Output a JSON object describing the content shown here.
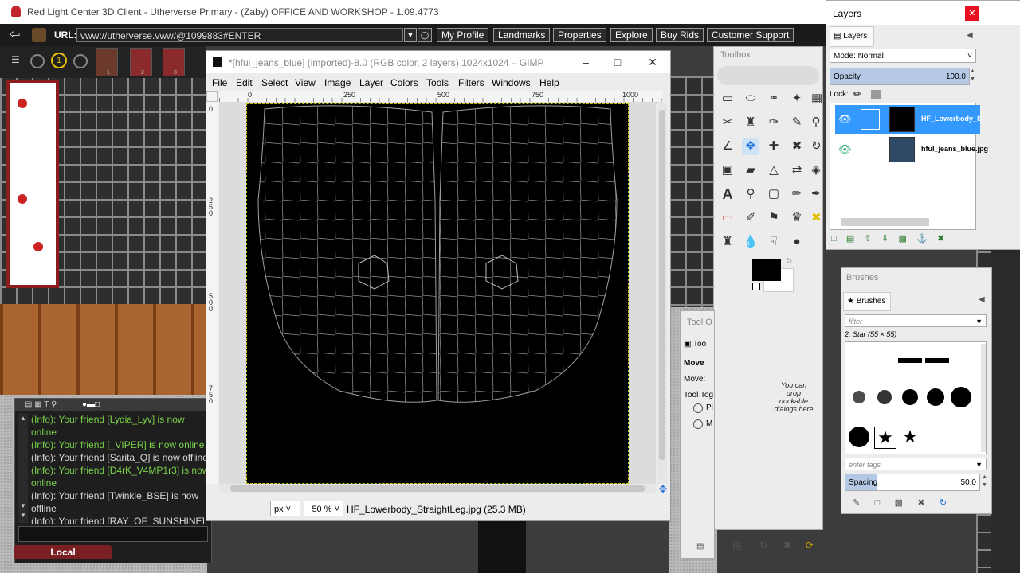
{
  "client": {
    "title": "Red Light Center 3D Client - Utherverse Primary - (Zaby) OFFICE AND WORKSHOP - 1.09.4773",
    "url_label": "URL:",
    "url_value": "vww://utherverse.vww/@1099883#ENTER",
    "nav_buttons": [
      "My Profile",
      "Landmarks",
      "Properties",
      "Explore",
      "Buy Rids",
      "Customer Support"
    ],
    "avatar_numbers": [
      "1",
      "2",
      "3"
    ]
  },
  "chat": {
    "lines": [
      {
        "text": "(Info): Your friend [Lydia_Lyv] is now online",
        "color": "#7ad14a"
      },
      {
        "text": "(Info): Your friend [_VIPER] is now online",
        "color": "#7ad14a"
      },
      {
        "text": "(Info): Your friend [Sarita_Q] is now offline",
        "color": "#d8d8d8"
      },
      {
        "text": "(Info): Your friend [D4rK_V4MP1r3] is now online",
        "color": "#7ad14a"
      },
      {
        "text": "(Info): Your friend [Twinkle_BSE] is now offline",
        "color": "#d8d8d8"
      },
      {
        "text": "(Info): Your friend [RAY_OF_SUNSHINE] is now offline",
        "color": "#d8d8d8"
      }
    ],
    "channel_label": "Local"
  },
  "gimp": {
    "title": "*[hful_jeans_blue] (imported)-8.0 (RGB color, 2 layers) 1024x1024 – GIMP",
    "menu": [
      "File",
      "Edit",
      "Select",
      "View",
      "Image",
      "Layer",
      "Colors",
      "Tools",
      "Filters",
      "Windows",
      "Help"
    ],
    "ruler_top": [
      "0",
      "250",
      "500",
      "750",
      "1000"
    ],
    "ruler_left": [
      "0",
      "2\n5\n0",
      "5\n0\n0",
      "7\n5\n0"
    ],
    "unit": "px",
    "zoom": "50 %",
    "status": "HF_Lowerbody_StraightLeg.jpg (25.3 MB)"
  },
  "toolbox": {
    "title": "Toolbox",
    "drop_hint": "You can drop dockable dialogs here"
  },
  "tool_options": {
    "title": "Tool O",
    "tab": "Too",
    "name": "Move",
    "move_label": "Move:",
    "toggle_label": "Tool Tog",
    "opt1": "Pi",
    "opt2": "M"
  },
  "layers": {
    "window_title": "Layers",
    "tab": "Layers",
    "mode_label": "Mode: Normal",
    "opacity_label": "Opacity",
    "opacity_value": "100.0",
    "lock_label": "Lock:",
    "items": [
      {
        "name": "HF_Lowerbody_S",
        "selected": true
      },
      {
        "name": "hful_jeans_blue.jpg",
        "selected": false
      }
    ]
  },
  "brushes": {
    "window_title": "Brushes",
    "tab": "Brushes",
    "filter_placeholder": "filter",
    "current": "2. Star (55 × 55)",
    "tags_placeholder": "enter tags",
    "spacing_label": "Spacing",
    "spacing_value": "50.0"
  },
  "colors": {
    "gimp_selection": "#3399ff",
    "chat_online": "#7ad14a",
    "local_button": "#7a1f22"
  }
}
